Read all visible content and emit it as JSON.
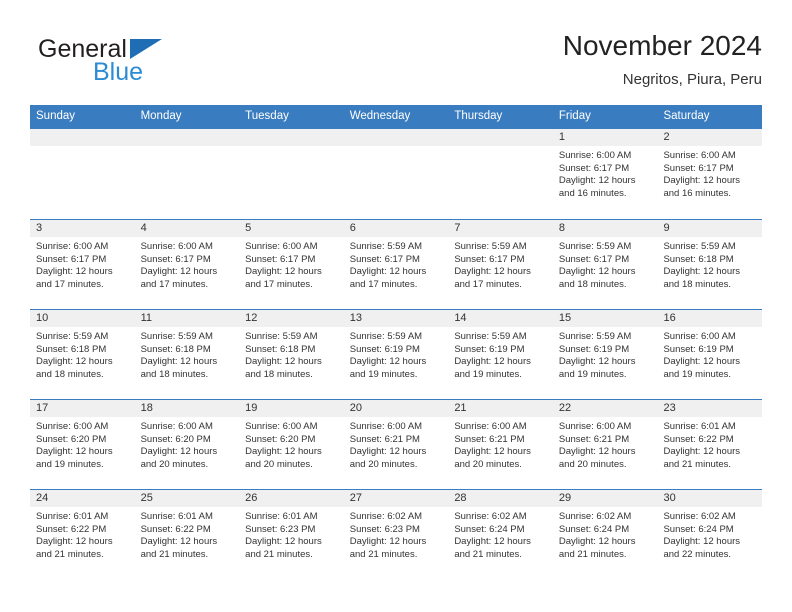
{
  "logo": {
    "line1": "General",
    "line2": "Blue",
    "flag_icon": "blue-triangle-flag-icon",
    "brand_color": "#2b8cd4"
  },
  "header": {
    "title": "November 2024",
    "subtitle": "Negritos, Piura, Peru"
  },
  "colors": {
    "header_band": "#3a7cc0",
    "day_head": "#f0f0f0",
    "text": "#333333"
  },
  "weekdays": [
    "Sunday",
    "Monday",
    "Tuesday",
    "Wednesday",
    "Thursday",
    "Friday",
    "Saturday"
  ],
  "weeks": [
    [
      {
        "date": "",
        "lines": []
      },
      {
        "date": "",
        "lines": []
      },
      {
        "date": "",
        "lines": []
      },
      {
        "date": "",
        "lines": []
      },
      {
        "date": "",
        "lines": []
      },
      {
        "date": "1",
        "lines": [
          "Sunrise: 6:00 AM",
          "Sunset: 6:17 PM",
          "Daylight: 12 hours",
          "and 16 minutes."
        ]
      },
      {
        "date": "2",
        "lines": [
          "Sunrise: 6:00 AM",
          "Sunset: 6:17 PM",
          "Daylight: 12 hours",
          "and 16 minutes."
        ]
      }
    ],
    [
      {
        "date": "3",
        "lines": [
          "Sunrise: 6:00 AM",
          "Sunset: 6:17 PM",
          "Daylight: 12 hours",
          "and 17 minutes."
        ]
      },
      {
        "date": "4",
        "lines": [
          "Sunrise: 6:00 AM",
          "Sunset: 6:17 PM",
          "Daylight: 12 hours",
          "and 17 minutes."
        ]
      },
      {
        "date": "5",
        "lines": [
          "Sunrise: 6:00 AM",
          "Sunset: 6:17 PM",
          "Daylight: 12 hours",
          "and 17 minutes."
        ]
      },
      {
        "date": "6",
        "lines": [
          "Sunrise: 5:59 AM",
          "Sunset: 6:17 PM",
          "Daylight: 12 hours",
          "and 17 minutes."
        ]
      },
      {
        "date": "7",
        "lines": [
          "Sunrise: 5:59 AM",
          "Sunset: 6:17 PM",
          "Daylight: 12 hours",
          "and 17 minutes."
        ]
      },
      {
        "date": "8",
        "lines": [
          "Sunrise: 5:59 AM",
          "Sunset: 6:17 PM",
          "Daylight: 12 hours",
          "and 18 minutes."
        ]
      },
      {
        "date": "9",
        "lines": [
          "Sunrise: 5:59 AM",
          "Sunset: 6:18 PM",
          "Daylight: 12 hours",
          "and 18 minutes."
        ]
      }
    ],
    [
      {
        "date": "10",
        "lines": [
          "Sunrise: 5:59 AM",
          "Sunset: 6:18 PM",
          "Daylight: 12 hours",
          "and 18 minutes."
        ]
      },
      {
        "date": "11",
        "lines": [
          "Sunrise: 5:59 AM",
          "Sunset: 6:18 PM",
          "Daylight: 12 hours",
          "and 18 minutes."
        ]
      },
      {
        "date": "12",
        "lines": [
          "Sunrise: 5:59 AM",
          "Sunset: 6:18 PM",
          "Daylight: 12 hours",
          "and 18 minutes."
        ]
      },
      {
        "date": "13",
        "lines": [
          "Sunrise: 5:59 AM",
          "Sunset: 6:19 PM",
          "Daylight: 12 hours",
          "and 19 minutes."
        ]
      },
      {
        "date": "14",
        "lines": [
          "Sunrise: 5:59 AM",
          "Sunset: 6:19 PM",
          "Daylight: 12 hours",
          "and 19 minutes."
        ]
      },
      {
        "date": "15",
        "lines": [
          "Sunrise: 5:59 AM",
          "Sunset: 6:19 PM",
          "Daylight: 12 hours",
          "and 19 minutes."
        ]
      },
      {
        "date": "16",
        "lines": [
          "Sunrise: 6:00 AM",
          "Sunset: 6:19 PM",
          "Daylight: 12 hours",
          "and 19 minutes."
        ]
      }
    ],
    [
      {
        "date": "17",
        "lines": [
          "Sunrise: 6:00 AM",
          "Sunset: 6:20 PM",
          "Daylight: 12 hours",
          "and 19 minutes."
        ]
      },
      {
        "date": "18",
        "lines": [
          "Sunrise: 6:00 AM",
          "Sunset: 6:20 PM",
          "Daylight: 12 hours",
          "and 20 minutes."
        ]
      },
      {
        "date": "19",
        "lines": [
          "Sunrise: 6:00 AM",
          "Sunset: 6:20 PM",
          "Daylight: 12 hours",
          "and 20 minutes."
        ]
      },
      {
        "date": "20",
        "lines": [
          "Sunrise: 6:00 AM",
          "Sunset: 6:21 PM",
          "Daylight: 12 hours",
          "and 20 minutes."
        ]
      },
      {
        "date": "21",
        "lines": [
          "Sunrise: 6:00 AM",
          "Sunset: 6:21 PM",
          "Daylight: 12 hours",
          "and 20 minutes."
        ]
      },
      {
        "date": "22",
        "lines": [
          "Sunrise: 6:00 AM",
          "Sunset: 6:21 PM",
          "Daylight: 12 hours",
          "and 20 minutes."
        ]
      },
      {
        "date": "23",
        "lines": [
          "Sunrise: 6:01 AM",
          "Sunset: 6:22 PM",
          "Daylight: 12 hours",
          "and 21 minutes."
        ]
      }
    ],
    [
      {
        "date": "24",
        "lines": [
          "Sunrise: 6:01 AM",
          "Sunset: 6:22 PM",
          "Daylight: 12 hours",
          "and 21 minutes."
        ]
      },
      {
        "date": "25",
        "lines": [
          "Sunrise: 6:01 AM",
          "Sunset: 6:22 PM",
          "Daylight: 12 hours",
          "and 21 minutes."
        ]
      },
      {
        "date": "26",
        "lines": [
          "Sunrise: 6:01 AM",
          "Sunset: 6:23 PM",
          "Daylight: 12 hours",
          "and 21 minutes."
        ]
      },
      {
        "date": "27",
        "lines": [
          "Sunrise: 6:02 AM",
          "Sunset: 6:23 PM",
          "Daylight: 12 hours",
          "and 21 minutes."
        ]
      },
      {
        "date": "28",
        "lines": [
          "Sunrise: 6:02 AM",
          "Sunset: 6:24 PM",
          "Daylight: 12 hours",
          "and 21 minutes."
        ]
      },
      {
        "date": "29",
        "lines": [
          "Sunrise: 6:02 AM",
          "Sunset: 6:24 PM",
          "Daylight: 12 hours",
          "and 21 minutes."
        ]
      },
      {
        "date": "30",
        "lines": [
          "Sunrise: 6:02 AM",
          "Sunset: 6:24 PM",
          "Daylight: 12 hours",
          "and 22 minutes."
        ]
      }
    ]
  ]
}
